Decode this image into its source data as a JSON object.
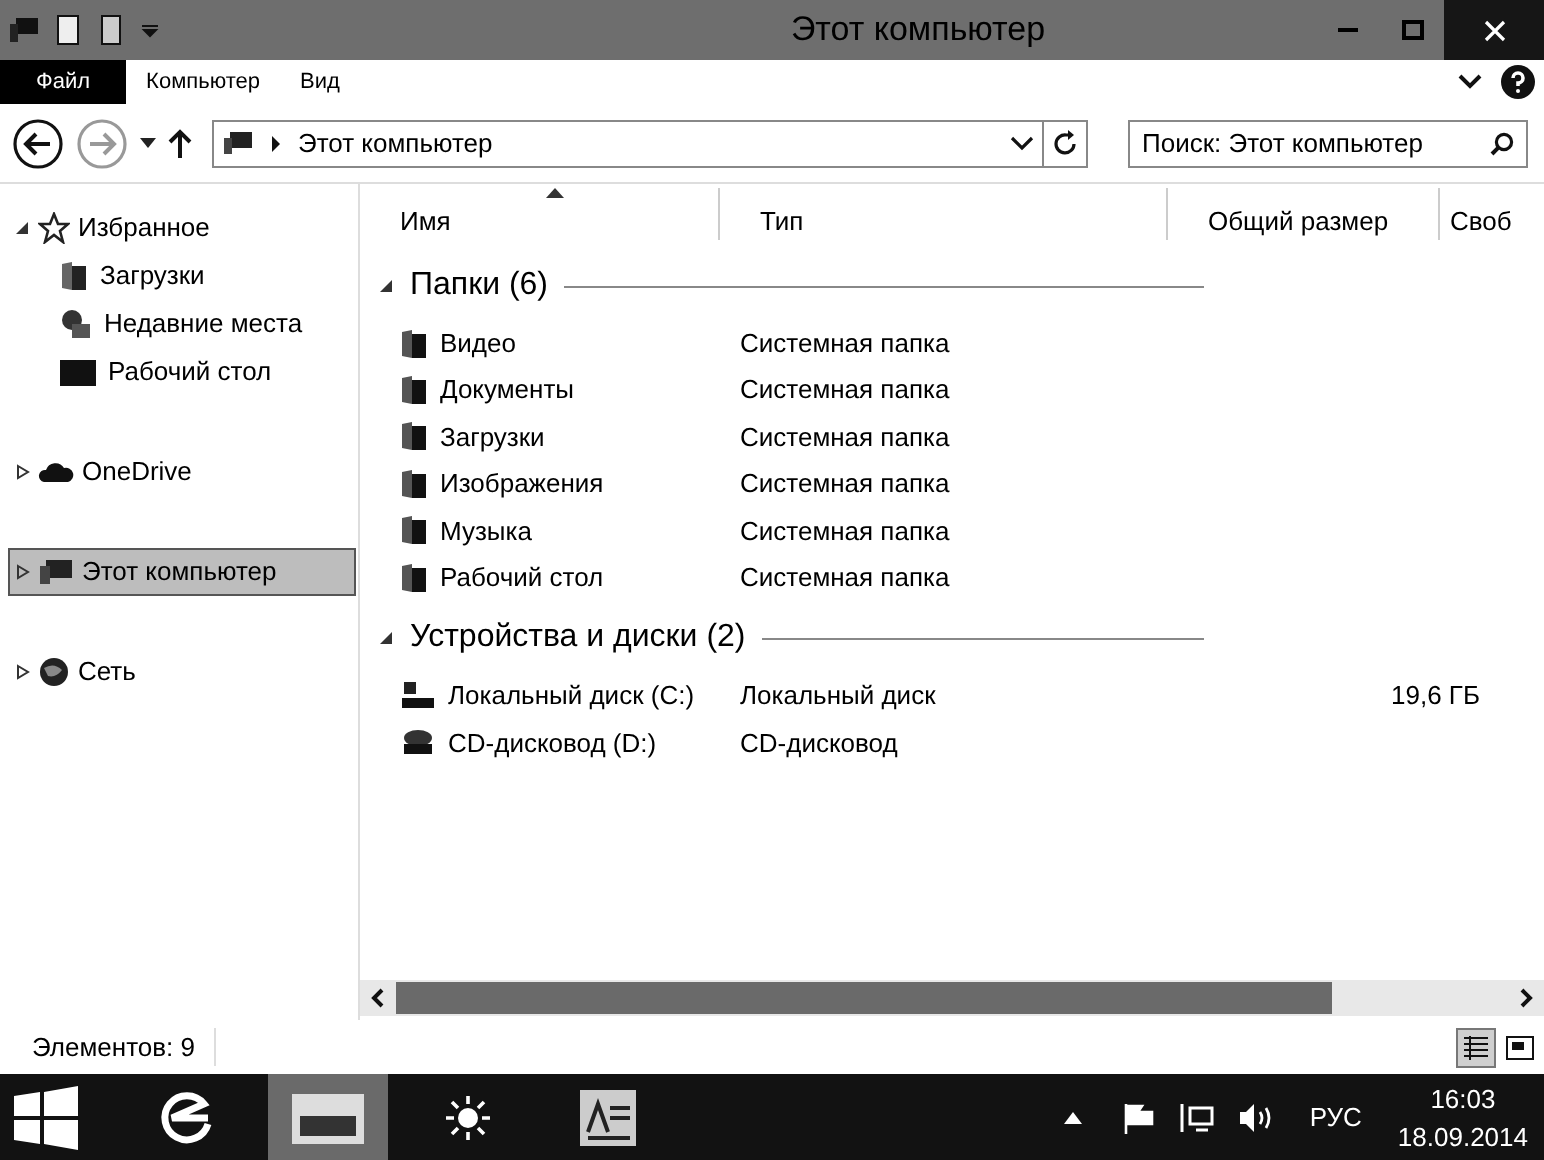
{
  "window": {
    "title": "Этот компьютер"
  },
  "ribbon": {
    "tabs": [
      {
        "label": "Файл",
        "selected": true
      },
      {
        "label": "Компьютер",
        "selected": false
      },
      {
        "label": "Вид",
        "selected": false
      }
    ]
  },
  "address": {
    "path": "Этот компьютер",
    "search_placeholder": "Поиск: Этот компьютер"
  },
  "nav": [
    {
      "label": "Избранное",
      "expanded": true,
      "selected": false,
      "children": [
        {
          "label": "Загрузки",
          "selected": false
        },
        {
          "label": "Недавние места",
          "selected": false
        },
        {
          "label": "Рабочий стол",
          "selected": false
        }
      ]
    },
    {
      "label": "OneDrive",
      "expanded": false,
      "selected": false
    },
    {
      "label": "Этот компьютер",
      "expanded": false,
      "selected": true
    },
    {
      "label": "Сеть",
      "expanded": false,
      "selected": false
    }
  ],
  "columns": [
    "Имя",
    "Тип",
    "Общий размер",
    "Своб"
  ],
  "groups": [
    {
      "title": "Папки (6)",
      "expanded": true,
      "items": [
        {
          "name": "Видео",
          "type": "Системная папка"
        },
        {
          "name": "Документы",
          "type": "Системная папка"
        },
        {
          "name": "Загрузки",
          "type": "Системная папка"
        },
        {
          "name": "Изображения",
          "type": "Системная папка"
        },
        {
          "name": "Музыка",
          "type": "Системная папка"
        },
        {
          "name": "Рабочий стол",
          "type": "Системная папка"
        }
      ]
    },
    {
      "title": "Устройства и диски (2)",
      "expanded": true,
      "items": [
        {
          "name": "Локальный диск (C:)",
          "type": "Локальный диск",
          "size": "19,6 ГБ"
        },
        {
          "name": "CD-дисковод (D:)",
          "type": "CD-дисковод"
        }
      ]
    }
  ],
  "status_bar": {
    "count": "Элементов: 9",
    "views": [
      {
        "selected": true
      },
      {
        "selected": false
      }
    ]
  },
  "taskbar": {
    "apps": [
      {
        "selected": false
      },
      {
        "selected": true
      },
      {
        "selected": false
      },
      {
        "selected": false
      }
    ],
    "language": "РУС",
    "time": "16:03",
    "date": "18.09.2014"
  }
}
